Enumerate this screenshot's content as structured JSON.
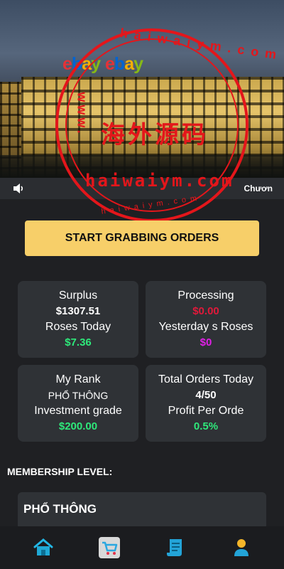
{
  "banner": {
    "logo_left": "ebay",
    "logo_right": "ebay",
    "marquee_text": "Chươn"
  },
  "watermark": {
    "chinese": "海外源码",
    "url": "haiwaiym.com",
    "arc_text": "haiwaiym.com",
    "small_text": "haiwaiym.com",
    "side_text": "www."
  },
  "cta": {
    "label": "START GRABBING ORDERS"
  },
  "stats": {
    "surplus_label": "Surplus",
    "surplus_value": "$1307.51",
    "roses_today_label": "Roses Today",
    "roses_today_value": "$7.36",
    "processing_label": "Processing",
    "processing_value": "$0.00",
    "yesterday_roses_label": "Yesterday s Roses",
    "yesterday_roses_value": "$0",
    "my_rank_label": "My Rank",
    "my_rank_value": "PHỔ THÔNG",
    "investment_grade_label": "Investment grade",
    "investment_grade_value": "$200.00",
    "total_orders_label": "Total Orders Today",
    "total_orders_value": "4/50",
    "profit_per_order_label": "Profit Per Orde",
    "profit_per_order_value": "0.5%"
  },
  "membership": {
    "title": "MEMBERSHIP LEVEL:",
    "level_name": "PHỔ THÔNG"
  },
  "nav": {
    "items": [
      "home-icon",
      "cart-icon",
      "orders-icon",
      "profile-icon"
    ]
  },
  "colors": {
    "accent": "#f7cf69",
    "green": "#2ee87a",
    "red": "#e0193a",
    "magenta": "#e020e6",
    "watermark": "#e4161b"
  }
}
